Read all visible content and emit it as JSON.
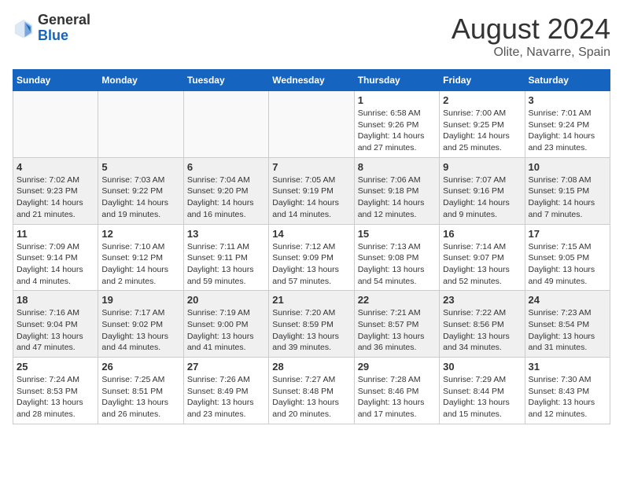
{
  "logo": {
    "general": "General",
    "blue": "Blue"
  },
  "header": {
    "month": "August 2024",
    "location": "Olite, Navarre, Spain"
  },
  "weekdays": [
    "Sunday",
    "Monday",
    "Tuesday",
    "Wednesday",
    "Thursday",
    "Friday",
    "Saturday"
  ],
  "weeks": [
    [
      {
        "day": "",
        "info": ""
      },
      {
        "day": "",
        "info": ""
      },
      {
        "day": "",
        "info": ""
      },
      {
        "day": "",
        "info": ""
      },
      {
        "day": "1",
        "info": "Sunrise: 6:58 AM\nSunset: 9:26 PM\nDaylight: 14 hours and 27 minutes."
      },
      {
        "day": "2",
        "info": "Sunrise: 7:00 AM\nSunset: 9:25 PM\nDaylight: 14 hours and 25 minutes."
      },
      {
        "day": "3",
        "info": "Sunrise: 7:01 AM\nSunset: 9:24 PM\nDaylight: 14 hours and 23 minutes."
      }
    ],
    [
      {
        "day": "4",
        "info": "Sunrise: 7:02 AM\nSunset: 9:23 PM\nDaylight: 14 hours and 21 minutes."
      },
      {
        "day": "5",
        "info": "Sunrise: 7:03 AM\nSunset: 9:22 PM\nDaylight: 14 hours and 19 minutes."
      },
      {
        "day": "6",
        "info": "Sunrise: 7:04 AM\nSunset: 9:20 PM\nDaylight: 14 hours and 16 minutes."
      },
      {
        "day": "7",
        "info": "Sunrise: 7:05 AM\nSunset: 9:19 PM\nDaylight: 14 hours and 14 minutes."
      },
      {
        "day": "8",
        "info": "Sunrise: 7:06 AM\nSunset: 9:18 PM\nDaylight: 14 hours and 12 minutes."
      },
      {
        "day": "9",
        "info": "Sunrise: 7:07 AM\nSunset: 9:16 PM\nDaylight: 14 hours and 9 minutes."
      },
      {
        "day": "10",
        "info": "Sunrise: 7:08 AM\nSunset: 9:15 PM\nDaylight: 14 hours and 7 minutes."
      }
    ],
    [
      {
        "day": "11",
        "info": "Sunrise: 7:09 AM\nSunset: 9:14 PM\nDaylight: 14 hours and 4 minutes."
      },
      {
        "day": "12",
        "info": "Sunrise: 7:10 AM\nSunset: 9:12 PM\nDaylight: 14 hours and 2 minutes."
      },
      {
        "day": "13",
        "info": "Sunrise: 7:11 AM\nSunset: 9:11 PM\nDaylight: 13 hours and 59 minutes."
      },
      {
        "day": "14",
        "info": "Sunrise: 7:12 AM\nSunset: 9:09 PM\nDaylight: 13 hours and 57 minutes."
      },
      {
        "day": "15",
        "info": "Sunrise: 7:13 AM\nSunset: 9:08 PM\nDaylight: 13 hours and 54 minutes."
      },
      {
        "day": "16",
        "info": "Sunrise: 7:14 AM\nSunset: 9:07 PM\nDaylight: 13 hours and 52 minutes."
      },
      {
        "day": "17",
        "info": "Sunrise: 7:15 AM\nSunset: 9:05 PM\nDaylight: 13 hours and 49 minutes."
      }
    ],
    [
      {
        "day": "18",
        "info": "Sunrise: 7:16 AM\nSunset: 9:04 PM\nDaylight: 13 hours and 47 minutes."
      },
      {
        "day": "19",
        "info": "Sunrise: 7:17 AM\nSunset: 9:02 PM\nDaylight: 13 hours and 44 minutes."
      },
      {
        "day": "20",
        "info": "Sunrise: 7:19 AM\nSunset: 9:00 PM\nDaylight: 13 hours and 41 minutes."
      },
      {
        "day": "21",
        "info": "Sunrise: 7:20 AM\nSunset: 8:59 PM\nDaylight: 13 hours and 39 minutes."
      },
      {
        "day": "22",
        "info": "Sunrise: 7:21 AM\nSunset: 8:57 PM\nDaylight: 13 hours and 36 minutes."
      },
      {
        "day": "23",
        "info": "Sunrise: 7:22 AM\nSunset: 8:56 PM\nDaylight: 13 hours and 34 minutes."
      },
      {
        "day": "24",
        "info": "Sunrise: 7:23 AM\nSunset: 8:54 PM\nDaylight: 13 hours and 31 minutes."
      }
    ],
    [
      {
        "day": "25",
        "info": "Sunrise: 7:24 AM\nSunset: 8:53 PM\nDaylight: 13 hours and 28 minutes."
      },
      {
        "day": "26",
        "info": "Sunrise: 7:25 AM\nSunset: 8:51 PM\nDaylight: 13 hours and 26 minutes."
      },
      {
        "day": "27",
        "info": "Sunrise: 7:26 AM\nSunset: 8:49 PM\nDaylight: 13 hours and 23 minutes."
      },
      {
        "day": "28",
        "info": "Sunrise: 7:27 AM\nSunset: 8:48 PM\nDaylight: 13 hours and 20 minutes."
      },
      {
        "day": "29",
        "info": "Sunrise: 7:28 AM\nSunset: 8:46 PM\nDaylight: 13 hours and 17 minutes."
      },
      {
        "day": "30",
        "info": "Sunrise: 7:29 AM\nSunset: 8:44 PM\nDaylight: 13 hours and 15 minutes."
      },
      {
        "day": "31",
        "info": "Sunrise: 7:30 AM\nSunset: 8:43 PM\nDaylight: 13 hours and 12 minutes."
      }
    ]
  ]
}
